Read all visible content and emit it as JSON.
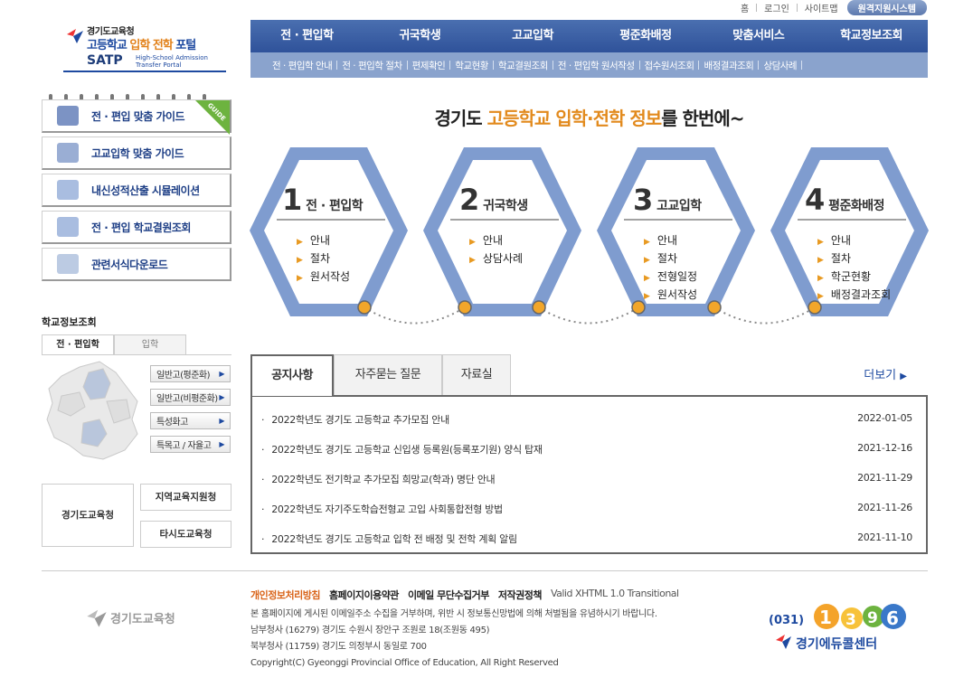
{
  "util": {
    "home": "홈",
    "login": "로그인",
    "sitemap": "사이트맵",
    "remote": "원격지원시스템"
  },
  "logo": {
    "org": "경기도교육청",
    "title_a": "고등학교 ",
    "title_b": "입학 전학",
    "title_c": " 포털",
    "satp": "SATP",
    "satp_sub1": "High-School Admission",
    "satp_sub2": "Transfer Portal"
  },
  "gnb": [
    "전 · 편입학",
    "귀국학생",
    "고교입학",
    "평준화배정",
    "맞춤서비스",
    "학교정보조회"
  ],
  "submenu": [
    "전 · 편입학 안내",
    "전 · 편입학 절차",
    "편제확인",
    "학교현황",
    "학교결원조회",
    "전 · 편입학 원서작성",
    "접수원서조회",
    "배정결과조회",
    "상담사례"
  ],
  "quick": [
    {
      "label": "전 · 편입 맞춤 가이드",
      "color": "#6d8bc7"
    },
    {
      "label": "고교입학 맞춤 가이드",
      "color": "#8fa3c9"
    },
    {
      "label": "내신성적산출 시뮬레이션",
      "color": "#9db5d8"
    },
    {
      "label": "전 · 편입 학교결원조회",
      "color": "#9db5d8"
    },
    {
      "label": "관련서식다운로드",
      "color": "#b7c6de"
    }
  ],
  "guide_tag": "GUIDE",
  "school": {
    "title": "학교정보조회",
    "tabs": [
      "전 · 편입학",
      "입학"
    ],
    "buttons": [
      "일반고(평준화)",
      "일반고(비평준화)",
      "특성화고",
      "특목고 / 자율고"
    ],
    "arrow": "▶"
  },
  "edu": {
    "main": "경기도교육청",
    "local": "지역교육지원청",
    "other": "타시도교육청"
  },
  "heading": {
    "pre": "경기도 ",
    "hl": "고등학교 입학·전학 정보",
    "post": "를 한번에~"
  },
  "hexes": [
    {
      "num": "1",
      "name": "전 · 편입학",
      "items": [
        "안내",
        "절차",
        "원서작성"
      ]
    },
    {
      "num": "2",
      "name": "귀국학생",
      "items": [
        "안내",
        "상담사례"
      ]
    },
    {
      "num": "3",
      "name": "고교입학",
      "items": [
        "안내",
        "절차",
        "전형일정",
        "원서작성"
      ]
    },
    {
      "num": "4",
      "name": "평준화배정",
      "items": [
        "안내",
        "절차",
        "학군현황",
        "배정결과조회"
      ]
    }
  ],
  "notice": {
    "tabs": [
      "공지사항",
      "자주묻는 질문",
      "자료실"
    ],
    "more": "더보기",
    "rows": [
      {
        "title": "2022학년도 경기도 고등학교 추가모집 안내",
        "date": "2022-01-05"
      },
      {
        "title": "2022학년도 경기도 고등학교 신입생 등록원(등록포기원) 양식 탑재",
        "date": "2021-12-16"
      },
      {
        "title": "2022학년도 전기학교 추가모집 희망교(학과) 명단 안내",
        "date": "2021-11-29"
      },
      {
        "title": "2022학년도 자기주도학습전형교 고입 사회통합전형 방법",
        "date": "2021-11-26"
      },
      {
        "title": "2022학년도 경기도 고등학교 입학 전 배정 및 전학 계획 알림",
        "date": "2021-11-10"
      }
    ]
  },
  "footer": {
    "logo": "경기도교육청",
    "links": [
      "개인정보처리방침",
      "홈페이지이용약관",
      "이메일 무단수집거부",
      "저작권정책"
    ],
    "valid": "Valid XHTML 1.0 Transitional",
    "info": [
      "본 홈페이지에 게시된 이메일주소 수집을 거부하며, 위반 시 정보통신망법에 의해 처벌됨을 유념하시기 바랍니다.",
      "남부청사 (16279) 경기도 수원시 장안구 조원로 18(조원동 495)",
      "북부청사 (11759) 경기도 의정부시 동일로 700",
      "Copyright(C) Gyeonggi Provincial Office of Education, All Right Reserved"
    ],
    "call_area": "(031)",
    "call_digits": [
      "1",
      "3",
      "9",
      "6"
    ],
    "call_name": "경기에듀콜센터"
  },
  "colors": {
    "primary": "#2f529a",
    "accent": "#e28a1d",
    "hex_outer": "#7f9ccf",
    "hex_inner": "#ffffff"
  }
}
